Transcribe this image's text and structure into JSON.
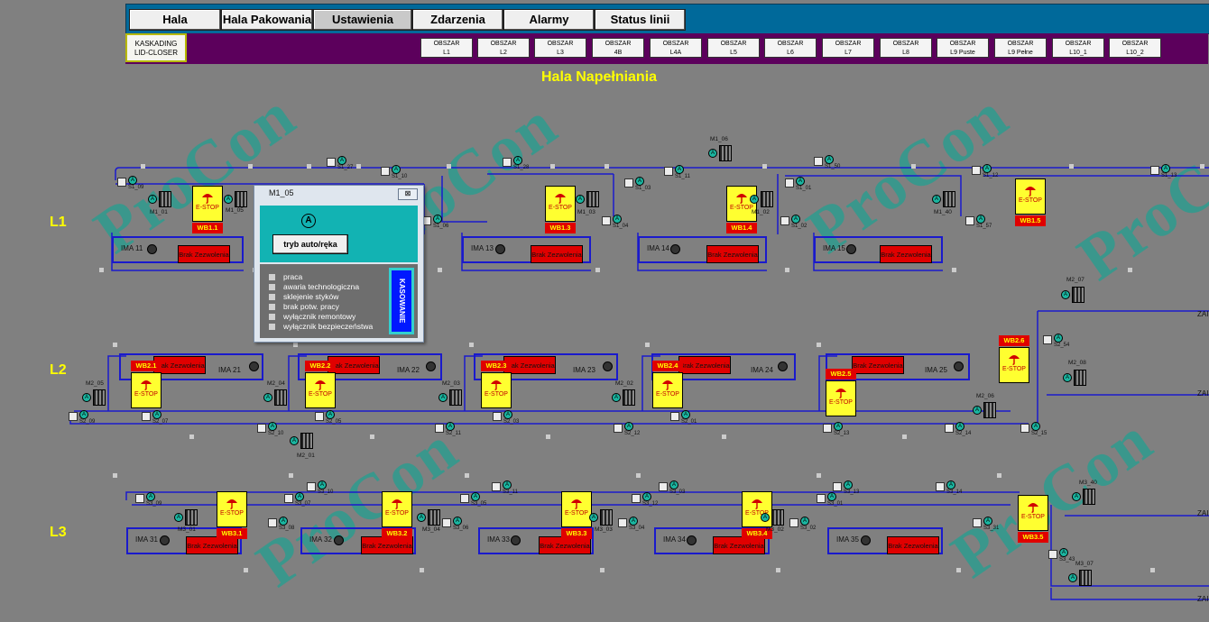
{
  "nav": {
    "tabs": [
      "Hala Napełniania",
      "Hala Pakowania",
      "Ustawienia",
      "Zdarzenia",
      "Alarmy",
      "Status linii"
    ],
    "kaskading": "KASKADING",
    "lid_closer": "LID-CLOSER",
    "obszar_label": "OBSZAR",
    "obszary": [
      "L1",
      "L2",
      "L3",
      "4B",
      "L4A",
      "L5",
      "L6",
      "L7",
      "L8",
      "L9 Puste",
      "L9 Pełne",
      "L10_1",
      "L10_2"
    ]
  },
  "hall_title": "Hala Napełniania",
  "watermark": "ProCon",
  "lines": [
    "L1",
    "L2",
    "L3"
  ],
  "brak_text": "Brak Zezwolenia",
  "estop_text": "E-STOP",
  "ima": [
    "IMA 11",
    "IMA 13",
    "IMA 14",
    "IMA 15",
    "IMA 21",
    "IMA 22",
    "IMA 23",
    "IMA 24",
    "IMA 25",
    "IMA 31",
    "IMA 32",
    "IMA 33",
    "IMA 34",
    "IMA 35"
  ],
  "wb": [
    "WB1.1",
    "WB1.3",
    "WB1.4",
    "WB1.5",
    "WB2.1",
    "WB2.2",
    "WB2.3",
    "WB2.4",
    "WB2.5",
    "WB2.6",
    "WB3.1",
    "WB3.2",
    "WB3.3",
    "WB3.4",
    "WB3.5"
  ],
  "motors": [
    "M1_06",
    "M1_01",
    "M1_05",
    "M1_03",
    "M1_02",
    "M1_40",
    "M2_07",
    "M2_08",
    "M2_05",
    "M2_04",
    "M2_03",
    "M2_02",
    "M2_06",
    "M2_01",
    "M3_40",
    "M3_01",
    "M3_04",
    "M3_03",
    "M3_02",
    "M3_07"
  ],
  "sensors": [
    "S1_27",
    "S1_09",
    "S1_10",
    "S1_28",
    "S1_03",
    "S1_11",
    "S1_50",
    "S1_01",
    "S1_12",
    "S1_13",
    "S1_06",
    "S1_04",
    "S1_02",
    "S1_57",
    "S2_54",
    "S2_09",
    "S2_07",
    "S2_10",
    "S2_05",
    "S2_11",
    "S2_03",
    "S2_12",
    "S2_01",
    "S2_13",
    "S2_14",
    "S2_15",
    "S3_09",
    "S3_07",
    "S3_10",
    "S3_05",
    "S3_11",
    "S3_12",
    "S3_03",
    "S3_13",
    "S3_14",
    "S3_01",
    "S3_08",
    "S3_06",
    "S3_04",
    "S3_02",
    "S3_31",
    "S3_43"
  ],
  "zai_label": "ZAI",
  "dialog": {
    "title": "M1_05",
    "close": "⊠",
    "a_symbol": "A",
    "mode_button": "tryb auto/ręka",
    "status": [
      "praca",
      "awaria technologiczna",
      "sklejenie styków",
      "brak potw. pracy",
      "wyłącznik remontowy",
      "wyłącznik bezpieczeństwa"
    ],
    "reset_button": "KASOWANIE"
  },
  "colors": {
    "nav_bg": "#00699a",
    "subbar_bg": "#5c005c",
    "title": "#ffff00",
    "conveyor": "#1a1acc",
    "estop": "#ffff30",
    "brak": "#e00000",
    "teal": "#12b3b3"
  }
}
